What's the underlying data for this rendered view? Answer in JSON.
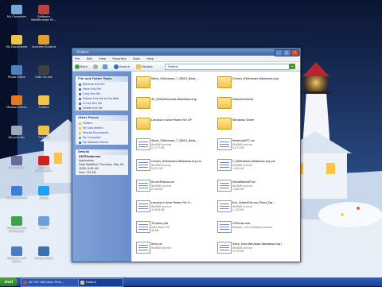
{
  "desktop_icons": [
    {
      "label": "My Computer",
      "color": "#7aa7d9"
    },
    {
      "label": "Software Walkthrough Sh...",
      "color": "#c04040"
    },
    {
      "label": "My Documents",
      "color": "#f0c34b"
    },
    {
      "label": "Lectures Student",
      "color": "#e0a030"
    },
    {
      "label": "Photo Editor",
      "color": "#5080c0"
    },
    {
      "label": "Hide CS.exe",
      "color": "#404040"
    },
    {
      "label": "Mozilla Firefox",
      "color": "#e87722"
    },
    {
      "label": "Folders",
      "color": "#f0c34b"
    },
    {
      "label": "Recycle Bin",
      "color": "#9ab"
    },
    {
      "label": "Folders",
      "color": "#f0c34b"
    },
    {
      "label": "PowerCope",
      "color": "#6a6a9a"
    },
    {
      "label": "YouTube Downloader",
      "color": "#cc2222"
    },
    {
      "label": "WindowsMedia",
      "color": "#3b7dd8"
    },
    {
      "label": "Skype",
      "color": "#1da1f2"
    },
    {
      "label": "Windows Live Messenger",
      "color": "#3fa34d"
    },
    {
      "label": "Safari",
      "color": "#6aa0d8"
    },
    {
      "label": "Windows Live Writer",
      "color": "#4a7bc8"
    },
    {
      "label": "Google Earth",
      "color": "#3b6fb0"
    }
  ],
  "window": {
    "title": "Folders",
    "menu": [
      "File",
      "Edit",
      "View",
      "Favorites",
      "Tools",
      "Help"
    ],
    "toolbar": {
      "back": "Back",
      "search": "Search",
      "folders": "Folders"
    },
    "address": "Folders",
    "go_label": "→"
  },
  "task_pane": {
    "file_tasks_header": "File and Folder Tasks",
    "file_tasks": [
      "Rename this file",
      "Move this file",
      "Copy this file",
      "Publish this file to the Web",
      "E-mail this file",
      "Delete this file"
    ],
    "other_places_header": "Other Places",
    "other_places": [
      "Folders",
      "My Documents",
      "Shared Documents",
      "My Computer",
      "My Network Places"
    ],
    "details_header": "Details",
    "details": [
      "USTFinder.exe",
      "Application",
      "Date Modified: Thursday, May 04, 2006, 8:46 AM",
      "Size: 752 KB"
    ]
  },
  "files": [
    {
      "name": "Word_CWindows_7_DBS1_Beta_...",
      "type": "",
      "size": "",
      "kind": "folder"
    },
    {
      "name": "Clones_XWindows.Webbase.org)",
      "type": "",
      "size": "",
      "kind": "folder"
    },
    {
      "name": "30_SMS(Windows.Webbase.org)",
      "type": "",
      "size": "",
      "kind": "folder"
    },
    {
      "name": "Detail/Listview",
      "type": "",
      "size": "",
      "kind": "folder"
    },
    {
      "name": "Longhorn Aero Power For XP",
      "type": "",
      "size": "",
      "kind": "folder"
    },
    {
      "name": "Windows Seller",
      "type": "",
      "size": "",
      "kind": "folder"
    },
    {
      "name": "Word_CWindows_7_DBS1_Beta_...",
      "type": "WinRAR archive",
      "size": "27,077 KB",
      "kind": "doc"
    },
    {
      "name": "NextLightTC.rar",
      "type": "WinRAR archive",
      "size": "6,071 KB",
      "kind": "doc"
    },
    {
      "name": "Clones_XWindows.Webbase.org.rar",
      "type": "WinRAR archive",
      "size": "5,917 KB",
      "kind": "doc"
    },
    {
      "name": "C_DWindows.Webbase.org.rar",
      "type": "WinRAR archive",
      "size": "1,063 KB",
      "kind": "doc"
    },
    {
      "name": "KirumPhotos.rar",
      "type": "WinRAR archive",
      "size": "2,028 KB",
      "kind": "doc"
    },
    {
      "name": "VistaMadeXP.rar",
      "type": "WinRAR archive",
      "size": "1,080 KB",
      "kind": "doc"
    },
    {
      "name": "Longhorn Aero Power For X...",
      "type": "WinRAR archive",
      "size": "19,818 KB",
      "kind": "doc"
    },
    {
      "name": "the_GlassXClones_Plane_Dp...",
      "type": "WinRAR archive",
      "size": "1,120 KB",
      "kind": "doc"
    },
    {
      "name": "Thumbs.jdb",
      "type": "Data Base File",
      "size": "46 KB",
      "kind": "doc"
    },
    {
      "name": "UTfinder.exe",
      "type": "Reorder, 1010 software patcher",
      "size": "",
      "kind": "doc"
    },
    {
      "name": "Sets.rar",
      "type": "WinRAR archive",
      "size": "",
      "kind": "doc"
    },
    {
      "name": "Vista_Skin(Windows.Webbase.org)",
      "type": "WinRAR archive",
      "size": "3,079 KB",
      "kind": "doc"
    }
  ],
  "taskbar": {
    "start_label": "start",
    "tasks": [
      {
        "label": "All 700 CaliColors Pictu...",
        "color": "#c43"
      },
      {
        "label": "Folders",
        "color": "#f0c34b"
      }
    ]
  },
  "colors": {
    "window_frame": "#3c5f8e",
    "task_pane": "#7fa1d8",
    "taskbar": "#2f5fbf"
  }
}
